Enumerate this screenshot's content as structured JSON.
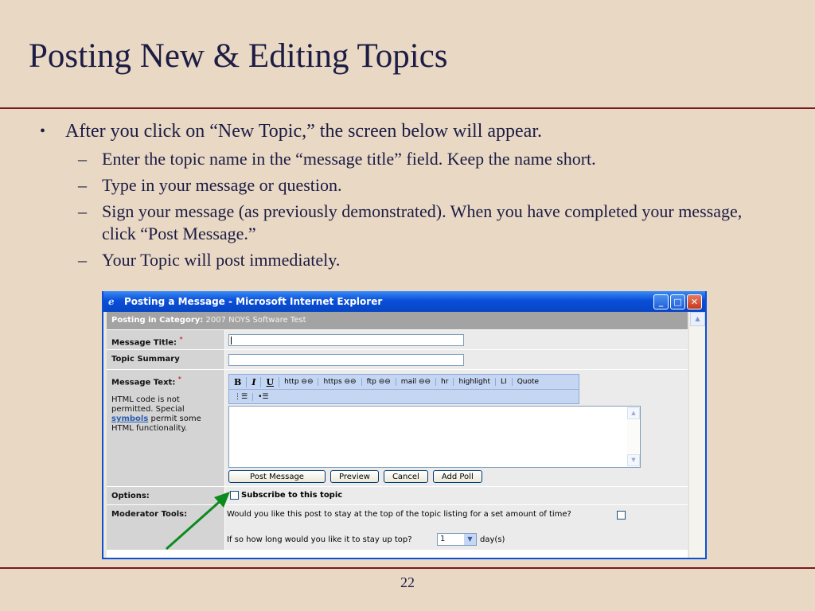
{
  "slide": {
    "title": "Posting New & Editing Topics",
    "page_number": "22",
    "bullets": {
      "main": "After you click on “New Topic,” the screen below will appear.",
      "sub": [
        "Enter the topic name in the “message title” field.  Keep the name short.",
        "Type in your message or question.",
        "Sign your message (as previously demonstrated). When you have completed your message, click “Post Message.”",
        "Your Topic will post immediately."
      ]
    }
  },
  "window": {
    "title": "Posting a Message - Microsoft Internet Explorer",
    "category_label": "Posting in Category:",
    "category_value": "2007 NOYS Software Test",
    "message_title_label": "Message Title:",
    "required_mark": "*",
    "topic_summary_label": "Topic Summary",
    "message_text_label": "Message Text:",
    "help_text_before": "HTML code is not permitted. Special",
    "help_link": "symbols",
    "help_text_after": "permit some HTML functionality.",
    "toolbar": [
      "B",
      "I",
      "U",
      "http ⊖⊖",
      "https ⊖⊖",
      "ftp ⊖⊖",
      "mail ⊖⊖",
      "hr",
      "highlight",
      "LI",
      "Quote"
    ],
    "toolbar_row2": [
      "ordered-list-icon",
      "unordered-list-icon"
    ],
    "buttons": {
      "post": "Post Message",
      "preview": "Preview",
      "cancel": "Cancel",
      "add_poll": "Add Poll"
    },
    "options_label": "Options:",
    "subscribe_label": "Subscribe to this topic",
    "moderator_label": "Moderator Tools:",
    "sticky_question": "Would you like this post to stay at the top of the topic listing for a set amount of time?",
    "duration_question": "If so how long would you like it to stay up top?",
    "duration_value": "1",
    "duration_unit": "day(s)"
  },
  "colors": {
    "slide_bg": "#e8d8c4",
    "rule": "#7a1a1a",
    "titlebar": "#0a4fd8",
    "arrow": "#0c8a1e"
  }
}
